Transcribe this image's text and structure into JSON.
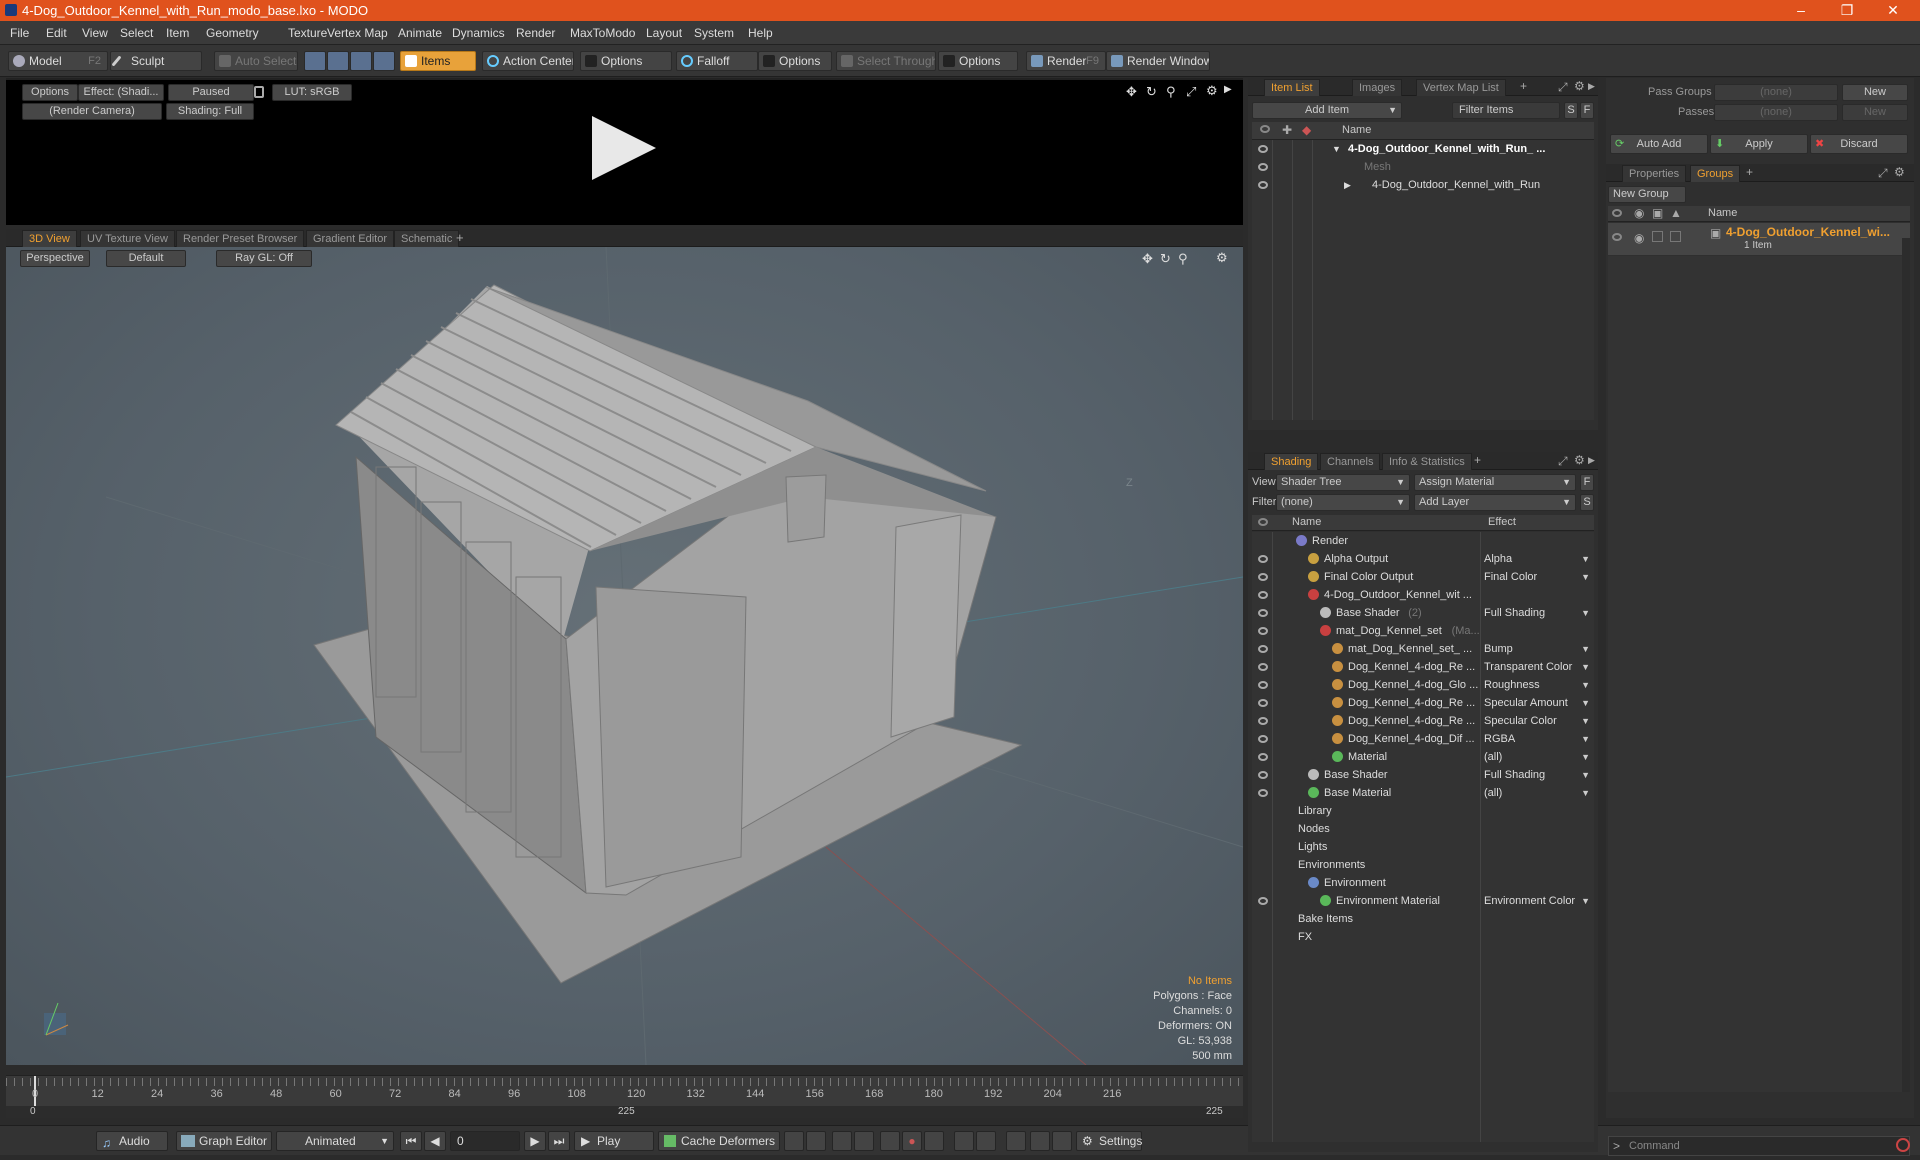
{
  "window": {
    "title": "4-Dog_Outdoor_Kennel_with_Run_modo_base.lxo - MODO"
  },
  "menu": [
    "File",
    "Edit",
    "View",
    "Select",
    "Item",
    "Geometry",
    "Texture",
    "Vertex Map",
    "Animate",
    "Dynamics",
    "Render",
    "MaxToModo",
    "Layout",
    "System",
    "Help"
  ],
  "toolbar": {
    "model": "Model",
    "model_key": "F2",
    "sculpt": "Sculpt",
    "auto_select": "Auto Select",
    "items": "Items",
    "action_center": "Action Center",
    "options1": "Options",
    "falloff": "Falloff",
    "options2": "Options",
    "select_through": "Select Through",
    "options3": "Options",
    "render": "Render",
    "render_key": "F9",
    "render_window": "Render Window"
  },
  "render_view": {
    "options": "Options",
    "effect": "Effect: (Shadi...",
    "paused": "Paused",
    "lut": "LUT: sRGB",
    "camera": "(Render Camera)",
    "shading": "Shading: Full"
  },
  "viewport_tabs": [
    "3D View",
    "UV Texture View",
    "Render Preset Browser",
    "Gradient Editor",
    "Schematic"
  ],
  "viewport": {
    "perspective": "Perspective",
    "default": "Default",
    "raygl": "Ray GL: Off",
    "no_items": "No Items",
    "polygons": "Polygons : Face",
    "channels": "Channels: 0",
    "deformers": "Deformers: ON",
    "gl": "GL: 53,938",
    "scale": "500 mm",
    "axis_label": "Z"
  },
  "timeline": {
    "ticks": [
      "0",
      "12",
      "24",
      "36",
      "48",
      "60",
      "72",
      "84",
      "96",
      "108",
      "120",
      "132",
      "144",
      "156",
      "168",
      "180",
      "192",
      "204",
      "216"
    ],
    "start": "0",
    "mid": "225",
    "end": "225"
  },
  "bottom": {
    "audio": "Audio",
    "graph_editor": "Graph Editor",
    "animated": "Animated",
    "frame": "0",
    "play": "Play",
    "cache": "Cache Deformers",
    "settings": "Settings"
  },
  "item_list": {
    "tabs": [
      "Item List",
      "Images",
      "Vertex Map List"
    ],
    "add_item": "Add Item",
    "filter": "Filter Items",
    "s": "S",
    "f": "F",
    "col_name": "Name",
    "rows": [
      "4-Dog_Outdoor_Kennel_with_Run_ ...",
      "Mesh",
      "4-Dog_Outdoor_Kennel_with_Run"
    ]
  },
  "shading": {
    "tabs": [
      "Shading",
      "Channels",
      "Info & Statistics"
    ],
    "view_label": "View",
    "view_value": "Shader Tree",
    "assign": "Assign Material",
    "f": "F",
    "filter_label": "Filter",
    "filter_value": "(none)",
    "add_layer": "Add Layer",
    "s": "S",
    "col_name": "Name",
    "col_effect": "Effect",
    "rows": [
      {
        "name": "Render",
        "effect": "",
        "indent": 0,
        "color": "#7a7ac8",
        "eye": false
      },
      {
        "name": "Alpha Output",
        "effect": "Alpha",
        "indent": 1,
        "color": "#c8a040",
        "eye": true
      },
      {
        "name": "Final Color Output",
        "effect": "Final Color",
        "indent": 1,
        "color": "#c8a040",
        "eye": true
      },
      {
        "name": "4-Dog_Outdoor_Kennel_wit ...",
        "effect": "",
        "indent": 1,
        "color": "#c84040",
        "eye": true
      },
      {
        "name": "Base Shader",
        "effect": "Full Shading",
        "indent": 2,
        "color": "#bbbbbb",
        "eye": true,
        "suffix": "(2)"
      },
      {
        "name": "mat_Dog_Kennel_set",
        "effect": "",
        "indent": 2,
        "color": "#c84040",
        "eye": true,
        "suffix": "(Ma..."
      },
      {
        "name": "mat_Dog_Kennel_set_ ...",
        "effect": "Bump",
        "indent": 3,
        "color": "#c89040",
        "eye": true
      },
      {
        "name": "Dog_Kennel_4-dog_Re ...",
        "effect": "Transparent Color",
        "indent": 3,
        "color": "#c89040",
        "eye": true
      },
      {
        "name": "Dog_Kennel_4-dog_Glo ...",
        "effect": "Roughness",
        "indent": 3,
        "color": "#c89040",
        "eye": true
      },
      {
        "name": "Dog_Kennel_4-dog_Re ...",
        "effect": "Specular Amount",
        "indent": 3,
        "color": "#c89040",
        "eye": true
      },
      {
        "name": "Dog_Kennel_4-dog_Re ...",
        "effect": "Specular Color",
        "indent": 3,
        "color": "#c89040",
        "eye": true
      },
      {
        "name": "Dog_Kennel_4-dog_Dif ...",
        "effect": "RGBA",
        "indent": 3,
        "color": "#c89040",
        "eye": true
      },
      {
        "name": "Material",
        "effect": "(all)",
        "indent": 3,
        "color": "#5ab85a",
        "eye": true
      },
      {
        "name": "Base Shader",
        "effect": "Full Shading",
        "indent": 1,
        "color": "#bbbbbb",
        "eye": true
      },
      {
        "name": "Base Material",
        "effect": "(all)",
        "indent": 1,
        "color": "#5ab85a",
        "eye": true
      },
      {
        "name": "Library",
        "effect": "",
        "indent": 0,
        "color": "",
        "eye": false
      },
      {
        "name": "Nodes",
        "effect": "",
        "indent": 0,
        "color": "",
        "eye": false
      },
      {
        "name": "Lights",
        "effect": "",
        "indent": 0,
        "color": "",
        "eye": false
      },
      {
        "name": "Environments",
        "effect": "",
        "indent": 0,
        "color": "",
        "eye": false
      },
      {
        "name": "Environment",
        "effect": "",
        "indent": 1,
        "color": "#6a8ac8",
        "eye": false
      },
      {
        "name": "Environment Material",
        "effect": "Environment Color",
        "indent": 2,
        "color": "#5ab85a",
        "eye": true
      },
      {
        "name": "Bake Items",
        "effect": "",
        "indent": 0,
        "color": "",
        "eye": false
      },
      {
        "name": "FX",
        "effect": "",
        "indent": 0,
        "color": "",
        "eye": false
      }
    ]
  },
  "right_panel": {
    "pass_groups": "Pass Groups",
    "passes": "Passes",
    "none1": "(none)",
    "none2": "(none)",
    "new1": "New",
    "new2": "New",
    "auto_add": "Auto Add",
    "apply": "Apply",
    "discard": "Discard",
    "tabs": [
      "Properties",
      "Groups"
    ],
    "new_group": "New Group",
    "col_name": "Name",
    "group_name": "4-Dog_Outdoor_Kennel_wi...",
    "group_count": "1 Item",
    "command": "Command"
  }
}
